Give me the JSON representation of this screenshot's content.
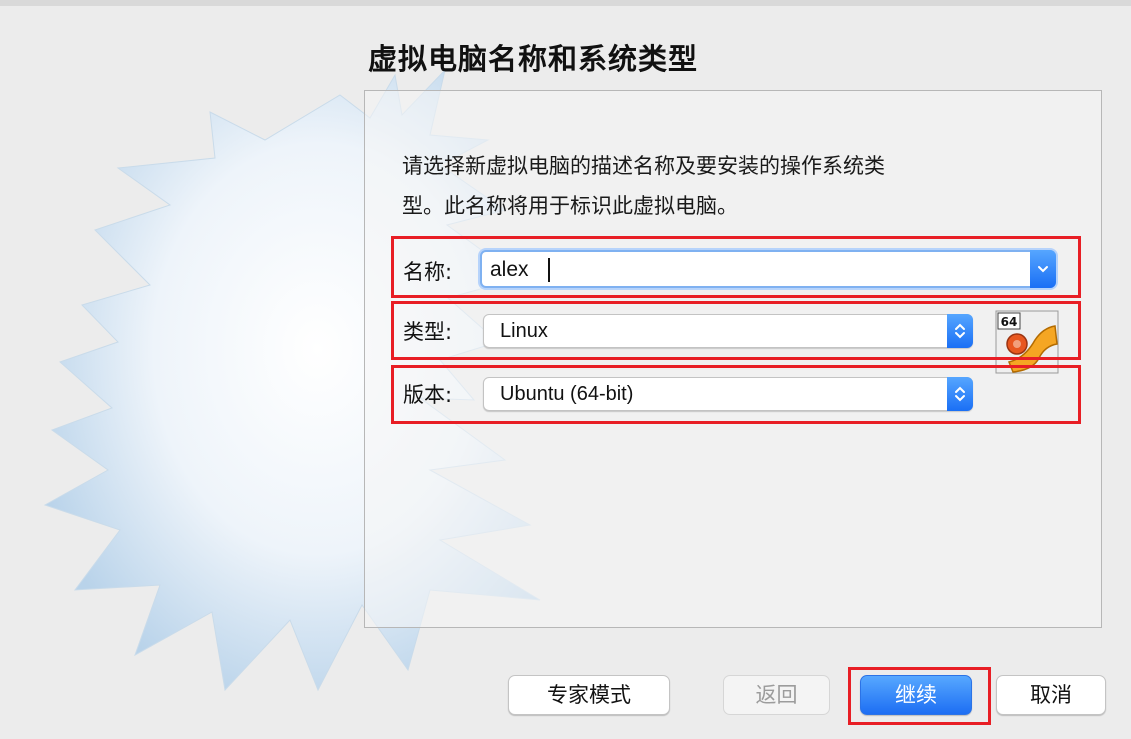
{
  "dialog": {
    "title": "虚拟电脑名称和系统类型",
    "description_line1": "请选择新虚拟电脑的描述名称及要安装的操作系统类",
    "description_line2": "型。此名称将用于标识此虚拟电脑。"
  },
  "form": {
    "name_label": "名称:",
    "name_value": "alex",
    "type_label": "类型:",
    "type_value": "Linux",
    "version_label": "版本:",
    "version_value": "Ubuntu (64-bit)",
    "os_icon_badge": "64"
  },
  "buttons": {
    "expert_mode": "专家模式",
    "back": "返回",
    "continue": "继续",
    "cancel": "取消"
  },
  "colors": {
    "highlight_red": "#e81e25",
    "accent_blue": "#1d6ef3"
  },
  "icons": {
    "name_dropdown": "chevron-down-icon",
    "type_select": "up-down-chevron-icon",
    "version_select": "up-down-chevron-icon",
    "os_logo": "ubuntu-64bit-icon"
  }
}
